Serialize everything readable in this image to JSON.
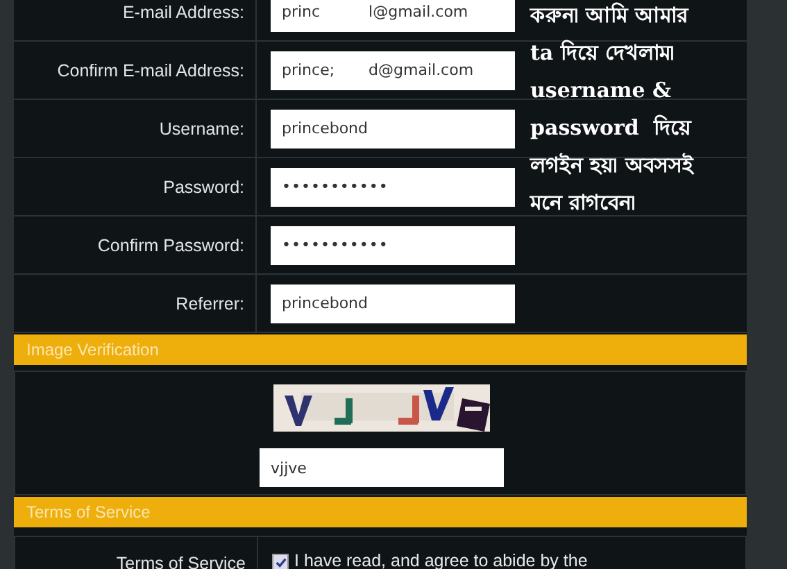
{
  "account_fields": [
    {
      "label": "E-mail Address:",
      "value": "princ          l@gmail.com",
      "kind": "text"
    },
    {
      "label": "Confirm E-mail Address:",
      "value": "prince;       d@gmail.com",
      "kind": "text"
    },
    {
      "label": "Username:",
      "value": "princebond",
      "kind": "text"
    },
    {
      "label": "Password:",
      "value": "•••••••••••",
      "kind": "password"
    },
    {
      "label": "Confirm Password:",
      "value": "•••••••••••",
      "kind": "password"
    },
    {
      "label": "Referrer:",
      "value": "princebond",
      "kind": "text"
    }
  ],
  "image_verification": {
    "header": "Image Verification",
    "answer": "vjjve"
  },
  "terms": {
    "header": "Terms of Service",
    "label": "Terms of Service",
    "agree_text": "I have read, and agree to abide by the",
    "checked": true
  },
  "annotation": [
    "করুন৷ আমি আমার",
    "ta দিয়ে দেখলাম৷",
    "username &",
    "password  দিয়ে",
    "লগইন হয়৷ অবসসই",
    "মনে রাগবেন৷"
  ]
}
